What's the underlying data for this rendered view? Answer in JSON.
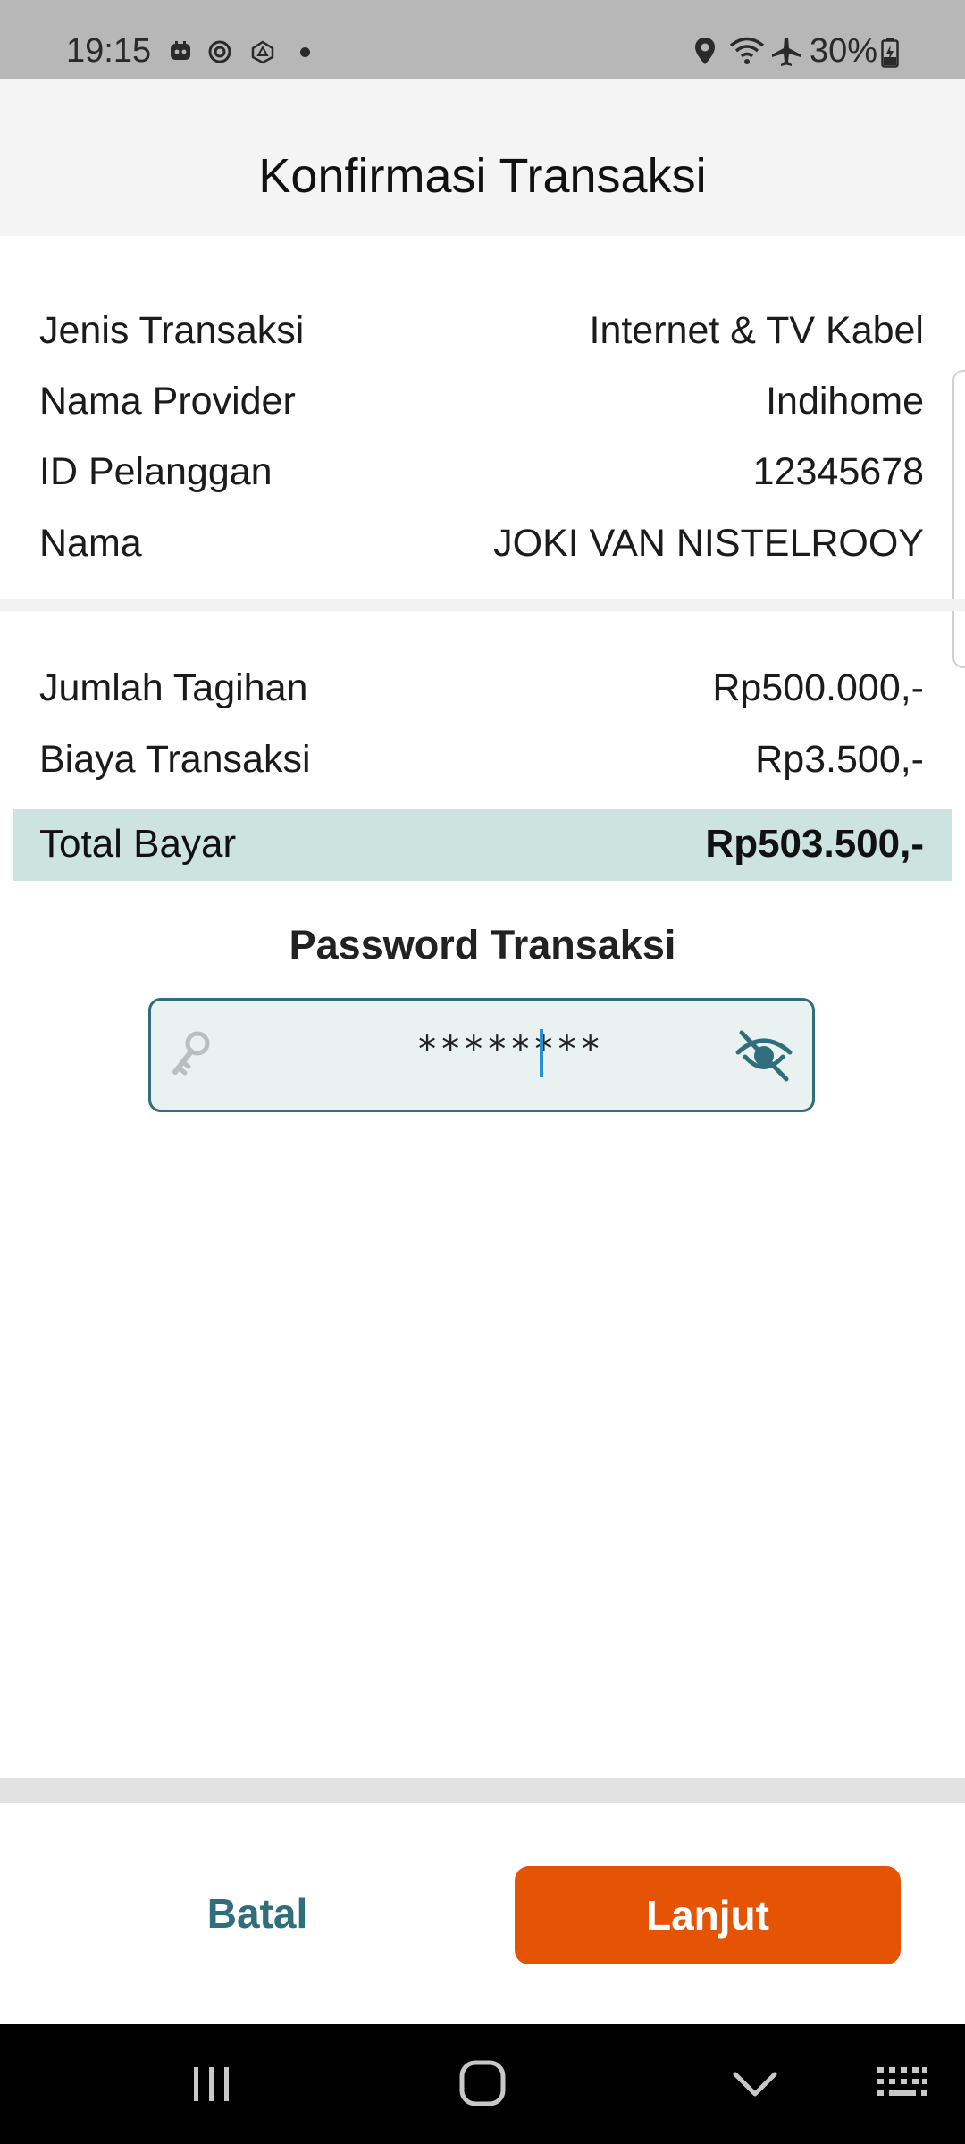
{
  "status_bar": {
    "time": "19:15",
    "battery_text": "30%",
    "icons": [
      "chat-notification-icon",
      "settings-notification-icon",
      "app-notification-icon",
      "location-icon",
      "wifi-icon",
      "airplane-icon",
      "battery-icon"
    ]
  },
  "header": {
    "title": "Konfirmasi Transaksi"
  },
  "details": [
    {
      "label": "Jenis Transaksi",
      "value": "Internet & TV Kabel"
    },
    {
      "label": "Nama Provider",
      "value": "Indihome"
    },
    {
      "label": "ID Pelanggan",
      "value": "12345678"
    },
    {
      "label": "Nama",
      "value": "JOKI VAN NISTELROOY"
    }
  ],
  "billing": [
    {
      "label": "Jumlah Tagihan",
      "value": "Rp500.000,-"
    },
    {
      "label": "Biaya Transaksi",
      "value": "Rp3.500,-"
    }
  ],
  "total": {
    "label": "Total Bayar",
    "value": "Rp503.500,-"
  },
  "password": {
    "title": "Password Transaksi",
    "value": "********",
    "leading_icon": "key-icon",
    "trailing_icon": "eye-off-icon"
  },
  "actions": {
    "cancel": "Batal",
    "continue": "Lanjut"
  },
  "colors": {
    "accent_teal": "#2f6e7a",
    "total_band": "#cde3df",
    "primary_button": "#e55304",
    "caret": "#2b8fd6"
  },
  "nav_bar": {
    "icons": [
      "recent-apps-icon",
      "home-icon",
      "back-icon",
      "keyboard-icon"
    ]
  }
}
